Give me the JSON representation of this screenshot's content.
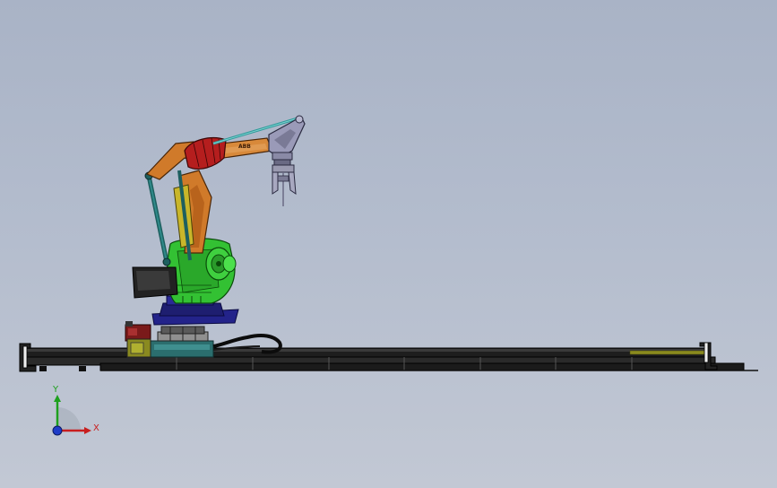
{
  "viewport": {
    "background_top": "#a9b3c6",
    "background_bottom": "#c2c8d4"
  },
  "model": {
    "arm_label": "ABB"
  },
  "triad": {
    "x_label": "X",
    "y_label": "Y",
    "x_color": "#c81e1e",
    "y_color": "#1ea01e",
    "z_color": "#1e3cc8"
  }
}
